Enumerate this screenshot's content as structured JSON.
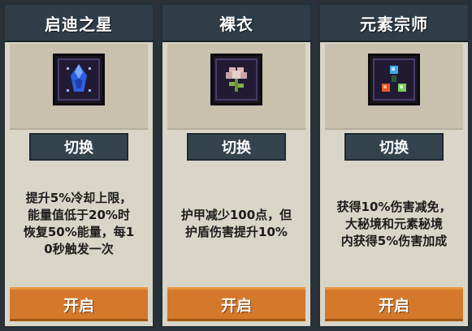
{
  "cards": [
    {
      "title": "启迪之星",
      "icon": "blue-crystal-icon",
      "switch_label": "切换",
      "description": "提升5%冷却上限，\n能量值低于20%时\n恢复50%能量，每1\n0秒触发一次",
      "open_label": "开启"
    },
    {
      "title": "裸衣",
      "icon": "flower-sprout-icon",
      "switch_label": "切换",
      "description": "护甲减少100点，但\n护盾伤害提升10%",
      "open_label": "开启"
    },
    {
      "title": "元素宗师",
      "icon": "elemental-orbs-icon",
      "switch_label": "切换",
      "description": "获得10%伤害减免，\n大秘境和元素秘境\n内获得5%伤害加成",
      "open_label": "开启"
    }
  ],
  "colors": {
    "header_bg": "#2e3d48",
    "card_bg": "#d9d5c7",
    "switch_button_bg": "#34444f",
    "open_button_bg": "#d4782b"
  }
}
